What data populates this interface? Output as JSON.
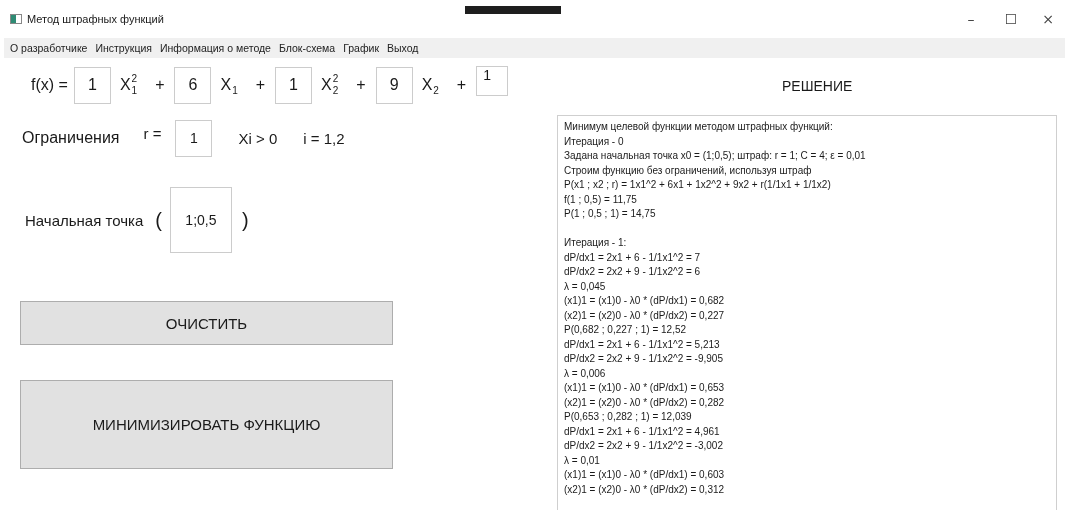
{
  "window": {
    "title": "Метод штрафных функций",
    "controls": [
      "–",
      "☐",
      "×"
    ]
  },
  "menu": [
    {
      "label": "О разработчике"
    },
    {
      "label": "Инструкция"
    },
    {
      "label": "Информация о методе"
    },
    {
      "label": "Блок-схема"
    },
    {
      "label": "График"
    },
    {
      "label": "Выход"
    }
  ],
  "formula": {
    "label": "f(x) =",
    "terms": [
      {
        "kind": "term",
        "coefficient": "1",
        "variable": "X",
        "superscript": "2",
        "subscript": "1"
      },
      {
        "kind": "operator",
        "text": "+"
      },
      {
        "kind": "term",
        "coefficient": "6",
        "variable": "X",
        "subscript": "1"
      },
      {
        "kind": "operator",
        "text": "+"
      },
      {
        "kind": "term",
        "coefficient": "1",
        "variable": "X",
        "superscript": "2",
        "subscript": "2"
      },
      {
        "kind": "operator",
        "text": "+"
      },
      {
        "kind": "term",
        "coefficient": "9",
        "variable": "X",
        "subscript": "2"
      },
      {
        "kind": "operator",
        "text": "+"
      },
      {
        "kind": "constant",
        "value": "1"
      }
    ]
  },
  "constraints": {
    "label": "Ограничения",
    "r_label": "r =",
    "r_value": "1",
    "condition": "Xi > 0",
    "index": "i = 1,2"
  },
  "start_point": {
    "label": "Начальная точка",
    "open": "(",
    "value": "1;0,5",
    "close": ")"
  },
  "buttons": [
    {
      "label": "ОЧИСТИТЬ",
      "kind": "small"
    },
    {
      "label": "МИНИМИЗИРОВАТЬ ФУНКЦИЮ",
      "kind": "large"
    }
  ],
  "solution": {
    "title": "РЕШЕНИЕ",
    "blocks": [
      [
        "Минимум целевой функции методом штрафных функций:",
        "Итерация - 0",
        "Задана начальная точка x0 = (1;0,5); штраф: r = 1; C = 4; ε = 0,01",
        "Строим функцию без ограничений, используя штраф",
        "P(x1 ; x2 ; r) = 1x1^2 + 6x1 + 1x2^2 + 9x2 + r(1/1x1 + 1/1x2)",
        "f(1 ; 0,5) = 11,75",
        "P(1 ; 0,5 ; 1) = 14,75"
      ],
      [
        "Итерация - 1:",
        "dP/dx1 = 2x1 + 6 - 1/1x1^2 = 7",
        "dP/dx2 = 2x2 + 9 - 1/1x2^2 = 6",
        "λ = 0,045",
        "(x1)1 = (x1)0 - λ0 * (dP/dx1) = 0,682",
        "(x2)1 = (x2)0 - λ0 * (dP/dx2) = 0,227",
        "P(0,682 ; 0,227 ; 1) = 12,52",
        "dP/dx1 = 2x1 + 6 - 1/1x1^2 = 5,213",
        "dP/dx2 = 2x2 + 9 - 1/1x2^2 = -9,905",
        "λ = 0,006",
        "(x1)1 = (x1)0 - λ0 * (dP/dx1) = 0,653",
        "(x2)1 = (x2)0 - λ0 * (dP/dx2) = 0,282",
        "P(0,653 ; 0,282 ; 1) = 12,039",
        "dP/dx1 = 2x1 + 6 - 1/1x1^2 = 4,961",
        "dP/dx2 = 2x2 + 9 - 1/1x2^2 = -3,002",
        "λ = 0,01",
        "(x1)1 = (x1)0 - λ0 * (dP/dx1) = 0,603",
        "(x2)1 = (x2)0 - λ0 * (dP/dx2) = 0,312"
      ]
    ]
  }
}
